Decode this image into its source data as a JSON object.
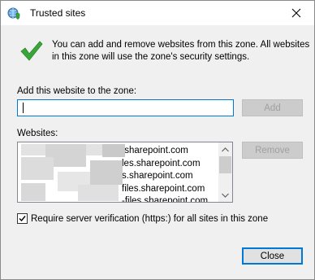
{
  "window": {
    "title": "Trusted sites",
    "close_glyph": "✕"
  },
  "intro_text": "You can add and remove websites from this zone. All websites in this zone will use the zone's security settings.",
  "add_section": {
    "label": "Add this website to the zone:",
    "input_value": "",
    "add_button": "Add"
  },
  "websites_section": {
    "label": "Websites:",
    "items": [
      ".sharepoint.com",
      "les.sharepoint.com",
      "s.sharepoint.com",
      "files.sharepoint.com",
      "-files.sharepoint.com"
    ],
    "remove_button": "Remove"
  },
  "require_verification": {
    "checked": true,
    "label": "Require server verification (https:) for all sites in this zone"
  },
  "close_button": "Close",
  "colors": {
    "accent": "#0078d7",
    "check_green": "#3aa53a",
    "dialog_bg": "#f0f0f0"
  },
  "icons": {
    "title": "globe-shield-icon",
    "intro": "green-check-icon",
    "close": "close-icon",
    "checkbox": "checkmark-icon",
    "scroll_up": "chevron-up-icon",
    "scroll_down": "chevron-down-icon"
  }
}
